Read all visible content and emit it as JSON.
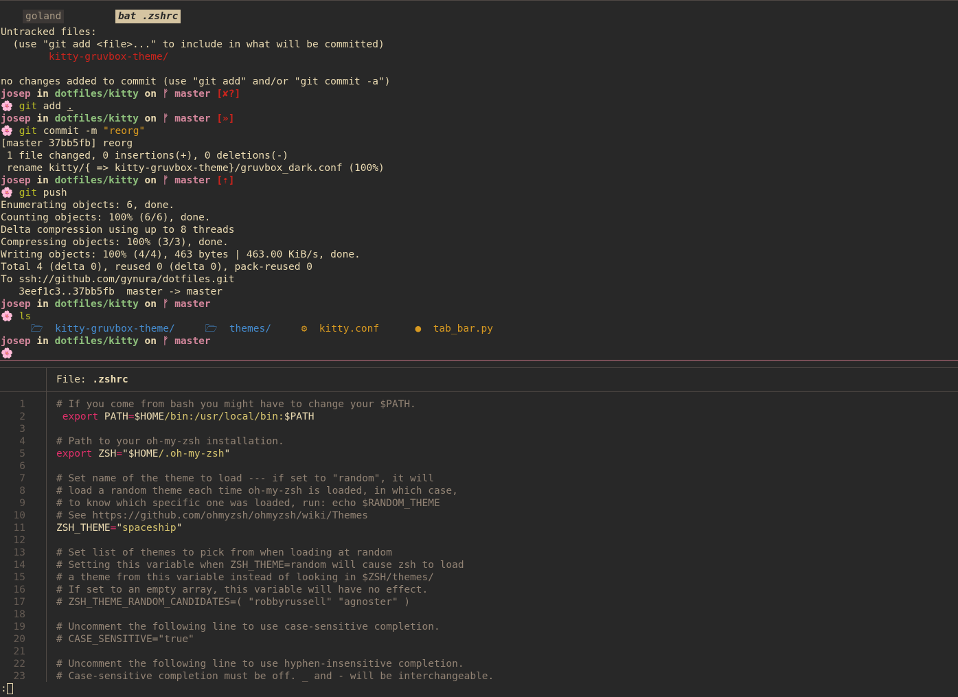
{
  "tabs": [
    {
      "label": "goland",
      "active": false
    },
    {
      "label": "bat .zshrc",
      "active": true
    }
  ],
  "terminal": {
    "lines": [
      {
        "type": "plain",
        "text": "Untracked files:"
      },
      {
        "type": "plain",
        "text": "  (use \"git add <file>...\" to include in what will be committed)"
      },
      {
        "type": "red",
        "text": "        kitty-gruvbox-theme/"
      },
      {
        "type": "plain",
        "text": ""
      },
      {
        "type": "plain",
        "text": "no changes added to commit (use \"git add\" and/or \"git commit -a\")"
      },
      {
        "type": "prompt",
        "user": "josep",
        "in": "in",
        "dir": "dotfiles/kitty",
        "on": "on",
        "branch_icon": "ᚠ",
        "branch": "master",
        "status": "[✘?]"
      },
      {
        "type": "command",
        "icon": "🌸",
        "cmd": "git",
        "args": "add",
        "arg2": "."
      },
      {
        "type": "prompt",
        "user": "josep",
        "in": "in",
        "dir": "dotfiles/kitty",
        "on": "on",
        "branch_icon": "ᚠ",
        "branch": "master",
        "status": "[»]"
      },
      {
        "type": "command",
        "icon": "🌸",
        "cmd": "git",
        "args": "commit -m",
        "arg2": "\"reorg\""
      },
      {
        "type": "plain",
        "text": "[master 37bb5fb] reorg"
      },
      {
        "type": "plain",
        "text": " 1 file changed, 0 insertions(+), 0 deletions(-)"
      },
      {
        "type": "plain",
        "text": " rename kitty/{ => kitty-gruvbox-theme}/gruvbox_dark.conf (100%)"
      },
      {
        "type": "prompt",
        "user": "josep",
        "in": "in",
        "dir": "dotfiles/kitty",
        "on": "on",
        "branch_icon": "ᚠ",
        "branch": "master",
        "status": "[⇡]"
      },
      {
        "type": "command",
        "icon": "🌸",
        "cmd": "git",
        "args": "push",
        "arg2": ""
      },
      {
        "type": "plain",
        "text": "Enumerating objects: 6, done."
      },
      {
        "type": "plain",
        "text": "Counting objects: 100% (6/6), done."
      },
      {
        "type": "plain",
        "text": "Delta compression using up to 8 threads"
      },
      {
        "type": "plain",
        "text": "Compressing objects: 100% (3/3), done."
      },
      {
        "type": "plain",
        "text": "Writing objects: 100% (4/4), 463 bytes | 463.00 KiB/s, done."
      },
      {
        "type": "plain",
        "text": "Total 4 (delta 0), reused 0 (delta 0), pack-reused 0"
      },
      {
        "type": "plain",
        "text": "To ssh://github.com/gynura/dotfiles.git"
      },
      {
        "type": "plain",
        "text": "   3eef1c3..37bb5fb  master -> master"
      },
      {
        "type": "prompt",
        "user": "josep",
        "in": "in",
        "dir": "dotfiles/kitty",
        "on": "on",
        "branch_icon": "ᚠ",
        "branch": "master",
        "status": ""
      },
      {
        "type": "command",
        "icon": "🌸",
        "cmd": "ls",
        "args": "",
        "arg2": ""
      },
      {
        "type": "ls"
      },
      {
        "type": "prompt",
        "user": "josep",
        "in": "in",
        "dir": "dotfiles/kitty",
        "on": "on",
        "branch_icon": "ᚠ",
        "branch": "master",
        "status": ""
      },
      {
        "type": "icon-only",
        "icon": "🌸"
      }
    ],
    "ls_items": [
      {
        "icon": "🗁",
        "icon_name": "folder-icon",
        "name": "kitty-gruvbox-theme/",
        "kind": "dir"
      },
      {
        "icon": "🗁",
        "icon_name": "folder-icon",
        "name": "themes/",
        "kind": "dir"
      },
      {
        "icon": "⚙",
        "icon_name": "gear-icon",
        "name": "kitty.conf",
        "kind": "conf"
      },
      {
        "icon": "●",
        "icon_name": "python-icon",
        "name": "tab_bar.py",
        "kind": "py"
      }
    ]
  },
  "bat": {
    "file_label": "File: ",
    "file_name": ".zshrc",
    "lines": [
      {
        "n": "1",
        "parts": [
          {
            "c": "comment",
            "t": "# If you come from bash you might have to change your $PATH."
          }
        ]
      },
      {
        "n": "2",
        "parts": [
          {
            "c": "plain",
            "t": " "
          },
          {
            "c": "export",
            "t": "export"
          },
          {
            "c": "plain",
            "t": " PATH"
          },
          {
            "c": "eq",
            "t": "="
          },
          {
            "c": "plain",
            "t": "$HOME"
          },
          {
            "c": "path",
            "t": "/bin:/usr/local/bin:"
          },
          {
            "c": "plain",
            "t": "$PATH"
          }
        ]
      },
      {
        "n": "3",
        "parts": []
      },
      {
        "n": "4",
        "parts": [
          {
            "c": "comment",
            "t": "# Path to your oh-my-zsh installation."
          }
        ]
      },
      {
        "n": "5",
        "parts": [
          {
            "c": "export",
            "t": "export"
          },
          {
            "c": "plain",
            "t": " ZSH"
          },
          {
            "c": "eq",
            "t": "="
          },
          {
            "c": "plain",
            "t": "\"$HOME"
          },
          {
            "c": "str",
            "t": "/.oh-my-zsh"
          },
          {
            "c": "plain",
            "t": "\""
          }
        ]
      },
      {
        "n": "6",
        "parts": []
      },
      {
        "n": "7",
        "parts": [
          {
            "c": "comment",
            "t": "# Set name of the theme to load --- if set to \"random\", it will"
          }
        ]
      },
      {
        "n": "8",
        "parts": [
          {
            "c": "comment",
            "t": "# load a random theme each time oh-my-zsh is loaded, in which case,"
          }
        ]
      },
      {
        "n": "9",
        "parts": [
          {
            "c": "comment",
            "t": "# to know which specific one was loaded, run: echo $RANDOM_THEME"
          }
        ]
      },
      {
        "n": "10",
        "parts": [
          {
            "c": "comment",
            "t": "# See https://github.com/ohmyzsh/ohmyzsh/wiki/Themes"
          }
        ]
      },
      {
        "n": "11",
        "parts": [
          {
            "c": "plain",
            "t": "ZSH_THEME"
          },
          {
            "c": "eq",
            "t": "="
          },
          {
            "c": "plain",
            "t": "\""
          },
          {
            "c": "str",
            "t": "spaceship"
          },
          {
            "c": "plain",
            "t": "\""
          }
        ]
      },
      {
        "n": "12",
        "parts": []
      },
      {
        "n": "13",
        "parts": [
          {
            "c": "comment",
            "t": "# Set list of themes to pick from when loading at random"
          }
        ]
      },
      {
        "n": "14",
        "parts": [
          {
            "c": "comment",
            "t": "# Setting this variable when ZSH_THEME=random will cause zsh to load"
          }
        ]
      },
      {
        "n": "15",
        "parts": [
          {
            "c": "comment",
            "t": "# a theme from this variable instead of looking in $ZSH/themes/"
          }
        ]
      },
      {
        "n": "16",
        "parts": [
          {
            "c": "comment",
            "t": "# If set to an empty array, this variable will have no effect."
          }
        ]
      },
      {
        "n": "17",
        "parts": [
          {
            "c": "comment",
            "t": "# ZSH_THEME_RANDOM_CANDIDATES=( \"robbyrussell\" \"agnoster\" )"
          }
        ]
      },
      {
        "n": "18",
        "parts": []
      },
      {
        "n": "19",
        "parts": [
          {
            "c": "comment",
            "t": "# Uncomment the following line to use case-sensitive completion."
          }
        ]
      },
      {
        "n": "20",
        "parts": [
          {
            "c": "comment",
            "t": "# CASE_SENSITIVE=\"true\""
          }
        ]
      },
      {
        "n": "21",
        "parts": []
      },
      {
        "n": "22",
        "parts": [
          {
            "c": "comment",
            "t": "# Uncomment the following line to use hyphen-insensitive completion."
          }
        ]
      },
      {
        "n": "23",
        "parts": [
          {
            "c": "comment",
            "t": "# Case-sensitive completion must be off. _ and - will be interchangeable."
          }
        ]
      }
    ]
  },
  "pager_prompt": ":"
}
